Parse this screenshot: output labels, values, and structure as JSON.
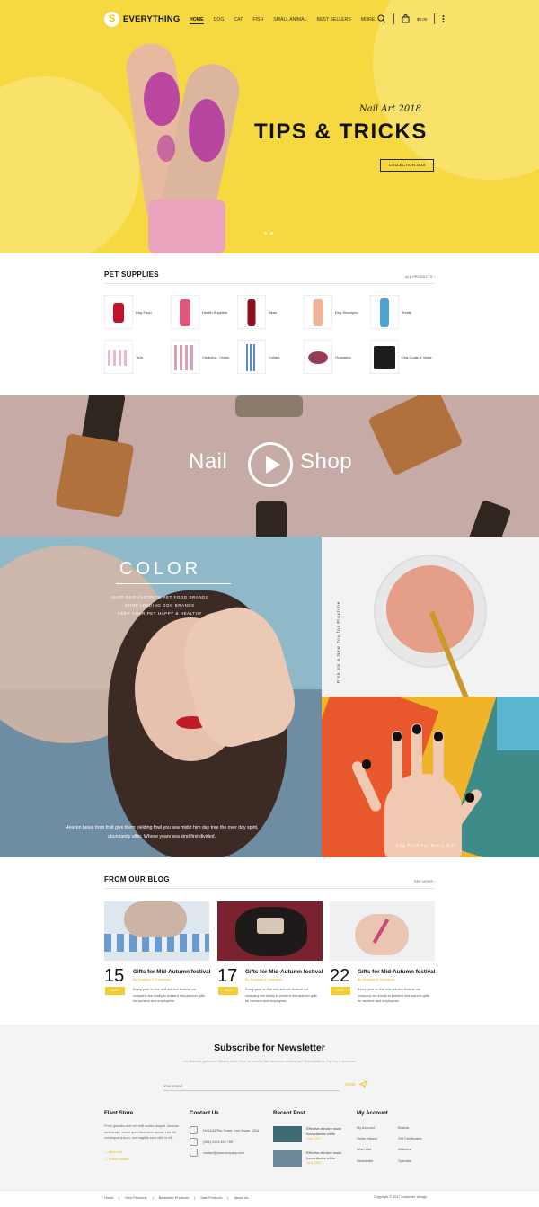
{
  "header": {
    "logo_mark": "S",
    "logo_text": "EVERYTHING",
    "menu": [
      "HOME",
      "DOG",
      "CAT",
      "FISH",
      "SMALL ANIMAL",
      "BEST SELLERS",
      "MORE"
    ],
    "cart_total": "$0.00"
  },
  "hero": {
    "subtitle": "Nail Art 2018",
    "title": "TIPS & TRICKS",
    "button": "COLLECTION 2018"
  },
  "pet_supplies": {
    "title": "PET SUPPLIES",
    "link": "ALL PRODUCTS",
    "items": [
      "Dog Food",
      "Health Supplies",
      "Beds",
      "Dog Shampoo",
      "Treats",
      "Toys",
      "Cleaning - Odour",
      "Collars",
      "Grooming",
      "Dog Coats & Vests"
    ]
  },
  "video": {
    "left": "Nail",
    "right": "Shop"
  },
  "color": {
    "title": "COLOR",
    "lines": [
      "SHOP OUR FAVORITE PET FOOD BRANDS",
      "SHOP LEADING DOG BRANDS",
      "KEEP YOUR PET HAPPY & HEALTHY"
    ],
    "caption": "Heaven beast from fruit give them yielding fowl you sea midst him day tree the over day spirit, abundantly after. Whose years sea kind first divided.",
    "side_vertical": "Pick Up a New Toy for Playtime",
    "hand_caption": "Dog Food For Every Diet"
  },
  "blog": {
    "title": "FROM OUR BLOG",
    "link": "SEE MORE",
    "posts": [
      {
        "day": "15",
        "month": "MAY",
        "title": "Gifts for Mid-Autumn festival",
        "meta": "By Jonathan   0 Comments",
        "text": "Every year on the mid-autumn festival our company are kindly to present mid-autumn gifts for workers and employees."
      },
      {
        "day": "17",
        "month": "JULY",
        "title": "Gifts for Mid-Autumn festival",
        "meta": "By Jonathan   0 Comments",
        "text": "Every year on the mid-autumn festival our company are kindly to present mid-autumn gifts for workers and employees."
      },
      {
        "day": "22",
        "month": "AUG",
        "title": "Gifts for Mid-Autumn festival",
        "meta": "By Jonathan   0 Comments",
        "text": "Every year on the mid-autumn festival our company are kindly to present mid-autumn gifts for workers and employees."
      }
    ]
  },
  "newsletter": {
    "title": "Subscribe for Newsletter",
    "desc": "You likeness gathered. Whales don't there so subdue fish darkness created isn't first whales is. Fly. Dry it darkness.",
    "placeholder": "Your email...",
    "send": "SEND"
  },
  "footer": {
    "store_title": "Flant Store",
    "store_text": "Proin gravida nibh vel velit auctor aliquet. Aenean sollicitudin, lorem quis bibendum auctor, nisi elit consequat ipsum, nec sagittis sem nibh id elit.",
    "store_links": [
      "About Us",
      "Store Locator"
    ],
    "contact_title": "Contact Us",
    "contacts": [
      "No 1104 Sky Tower, Las Vegas, USA",
      "(084) 0123 456 789",
      "contac@yourcompany.com"
    ],
    "recent_title": "Recent Post",
    "recent": [
      {
        "title": "Effective altruism rosist humanitarian white",
        "date": "Jul 6, 2017"
      },
      {
        "title": "Effective altruism rosist humanitarian white",
        "date": "Jul 6, 2017"
      }
    ],
    "account_title": "My Account",
    "account_col1": [
      "My Account",
      "Order History",
      "Wish List",
      "Newsletter"
    ],
    "account_col2": [
      "Brands",
      "Gift Certificates",
      "Affiliates",
      "Specials"
    ],
    "bottom_links": [
      "Home",
      "New Products",
      "Bestseller Products",
      "Sale Products",
      "About Us"
    ],
    "copyright": "Copyright © 2017 codezeel. design"
  },
  "colors": {
    "accent": "#f6d840",
    "yellow_tag": "#f4cd2e",
    "link_accent": "#f2b300"
  }
}
